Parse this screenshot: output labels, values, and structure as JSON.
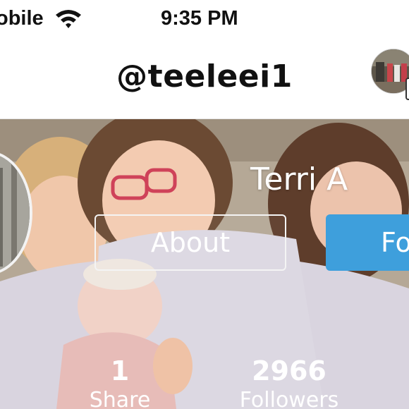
{
  "status_bar": {
    "carrier": "obile",
    "time": "9:35 PM"
  },
  "nav": {
    "handle": "@teeleei1"
  },
  "profile": {
    "display_name": "Terri A",
    "about_label": "About",
    "follow_label": "Fo",
    "stats": {
      "share_value": "1",
      "share_label": "Share",
      "followers_value": "2966",
      "followers_label": "Followers"
    }
  },
  "colors": {
    "follow_button": "#3e9fdc",
    "status_text": "#111111",
    "hero_text": "#ffffff"
  },
  "icons": [
    "wifi-icon",
    "nav-avatar",
    "profile-avatar"
  ]
}
